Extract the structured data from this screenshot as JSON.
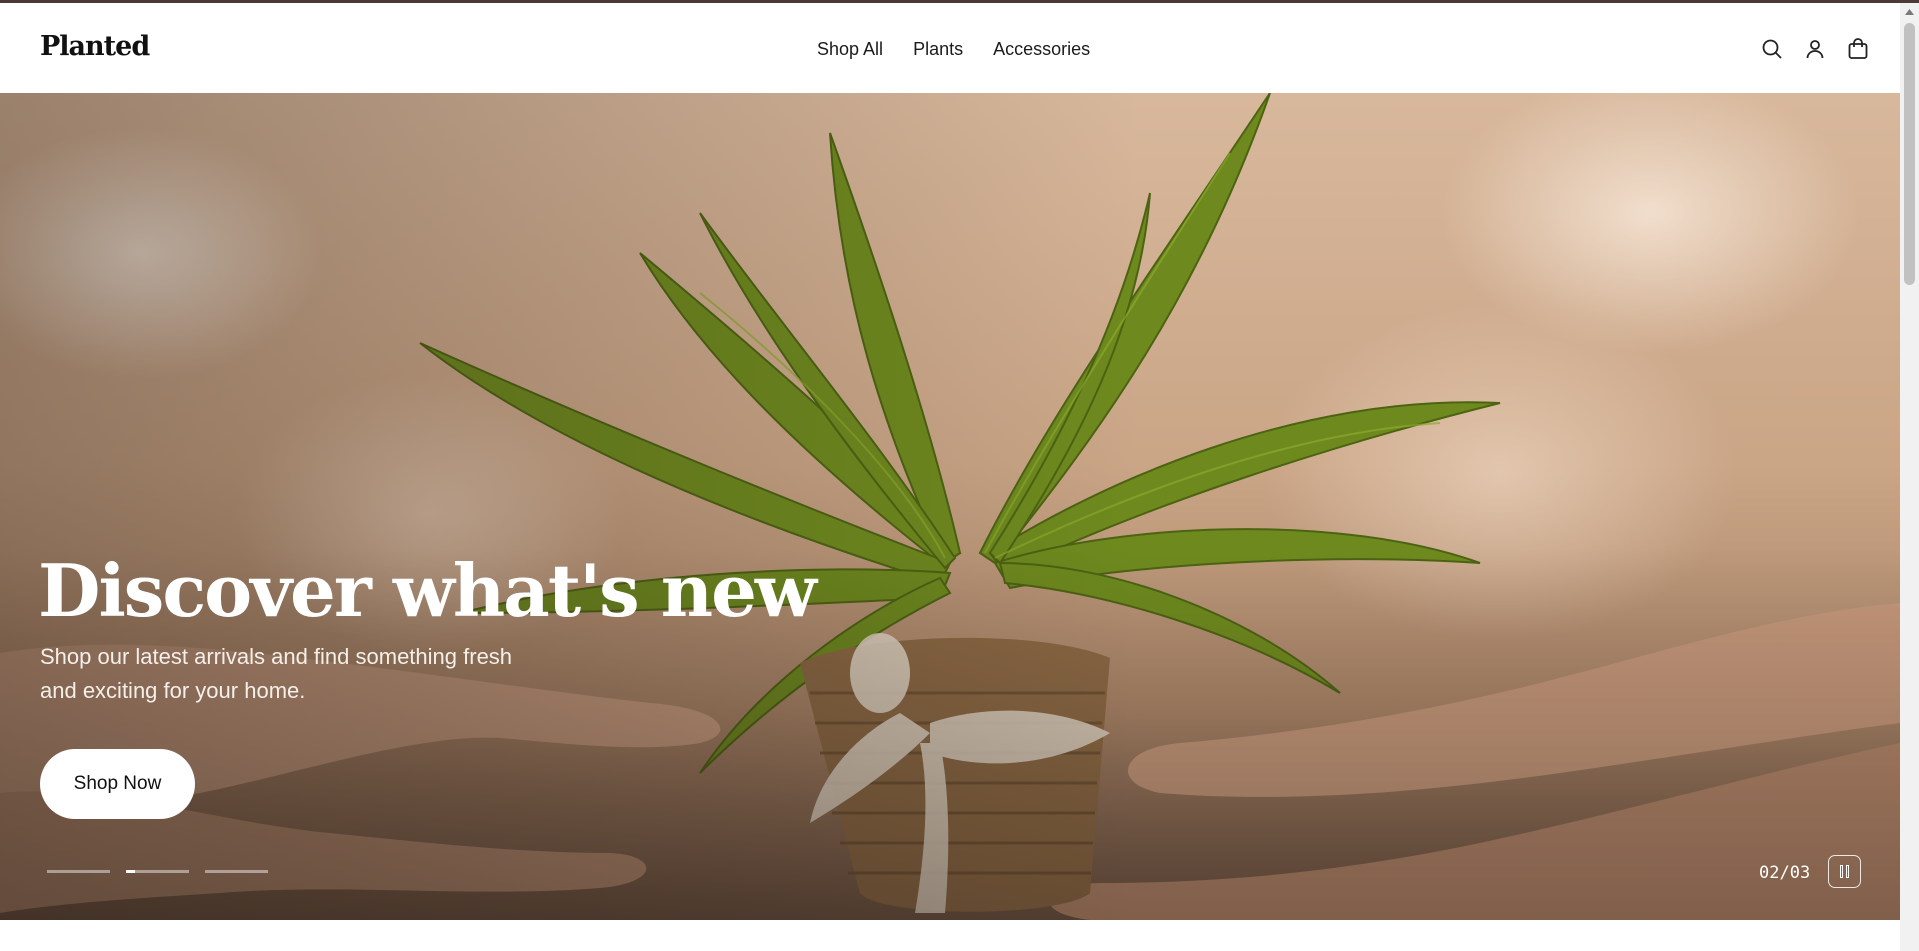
{
  "header": {
    "logo": "Planted",
    "nav": [
      {
        "label": "Shop All"
      },
      {
        "label": "Plants"
      },
      {
        "label": "Accessories"
      }
    ],
    "icons": [
      "search-icon",
      "account-icon",
      "cart-icon"
    ]
  },
  "hero": {
    "title": "Discover what's new",
    "subtitle": "Shop our latest arrivals and find something fresh and exciting for your home.",
    "cta_label": "Shop Now",
    "slide_counter": "02/03",
    "active_slide": 2,
    "slide_count": 3,
    "active_slide_progress": 0.15
  },
  "colors": {
    "text_dark": "#111111",
    "hero_text": "#ffffff",
    "topline": "#4a3b37"
  }
}
